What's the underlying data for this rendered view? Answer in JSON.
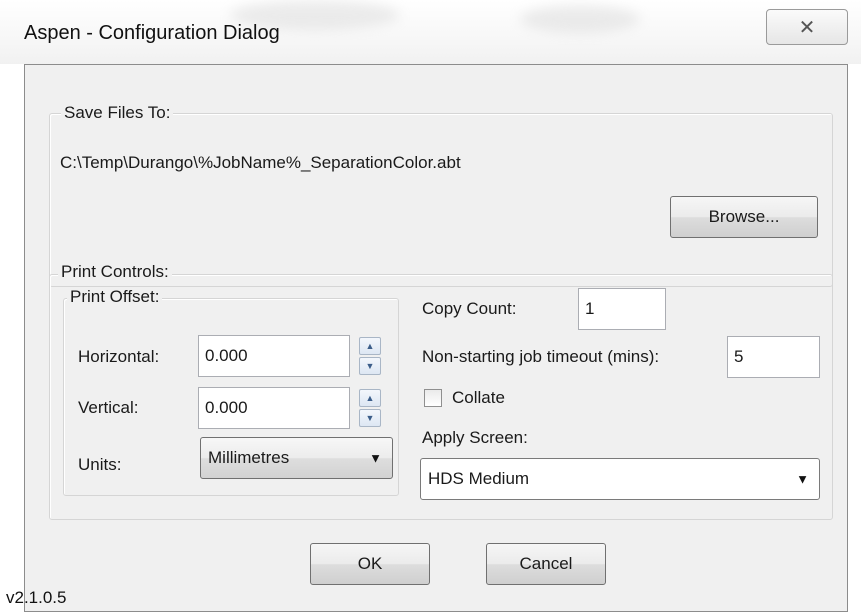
{
  "window": {
    "title": "Aspen - Configuration Dialog",
    "close_glyph": "✕"
  },
  "save_files": {
    "legend": "Save Files To:",
    "path": "C:\\Temp\\Durango\\%JobName%_SeparationColor.abt",
    "browse_label": "Browse..."
  },
  "print_controls": {
    "legend": "Print Controls:",
    "print_offset": {
      "legend": "Print Offset:",
      "horizontal_label": "Horizontal:",
      "horizontal_value": "0.000",
      "vertical_label": "Vertical:",
      "vertical_value": "0.000",
      "units_label": "Units:",
      "units_value": "Millimetres"
    },
    "copy_count_label": "Copy Count:",
    "copy_count_value": "1",
    "timeout_label": "Non-starting job timeout (mins):",
    "timeout_value": "5",
    "collate_label": "Collate",
    "collate_checked": false,
    "apply_screen_label": "Apply Screen:",
    "apply_screen_value": "HDS Medium"
  },
  "buttons": {
    "ok_label": "OK",
    "cancel_label": "Cancel"
  },
  "version": "v2.1.0.5",
  "icons": {
    "up": "up-arrow-icon",
    "down": "down-arrow-icon",
    "dropdown": "chevron-down-icon"
  }
}
